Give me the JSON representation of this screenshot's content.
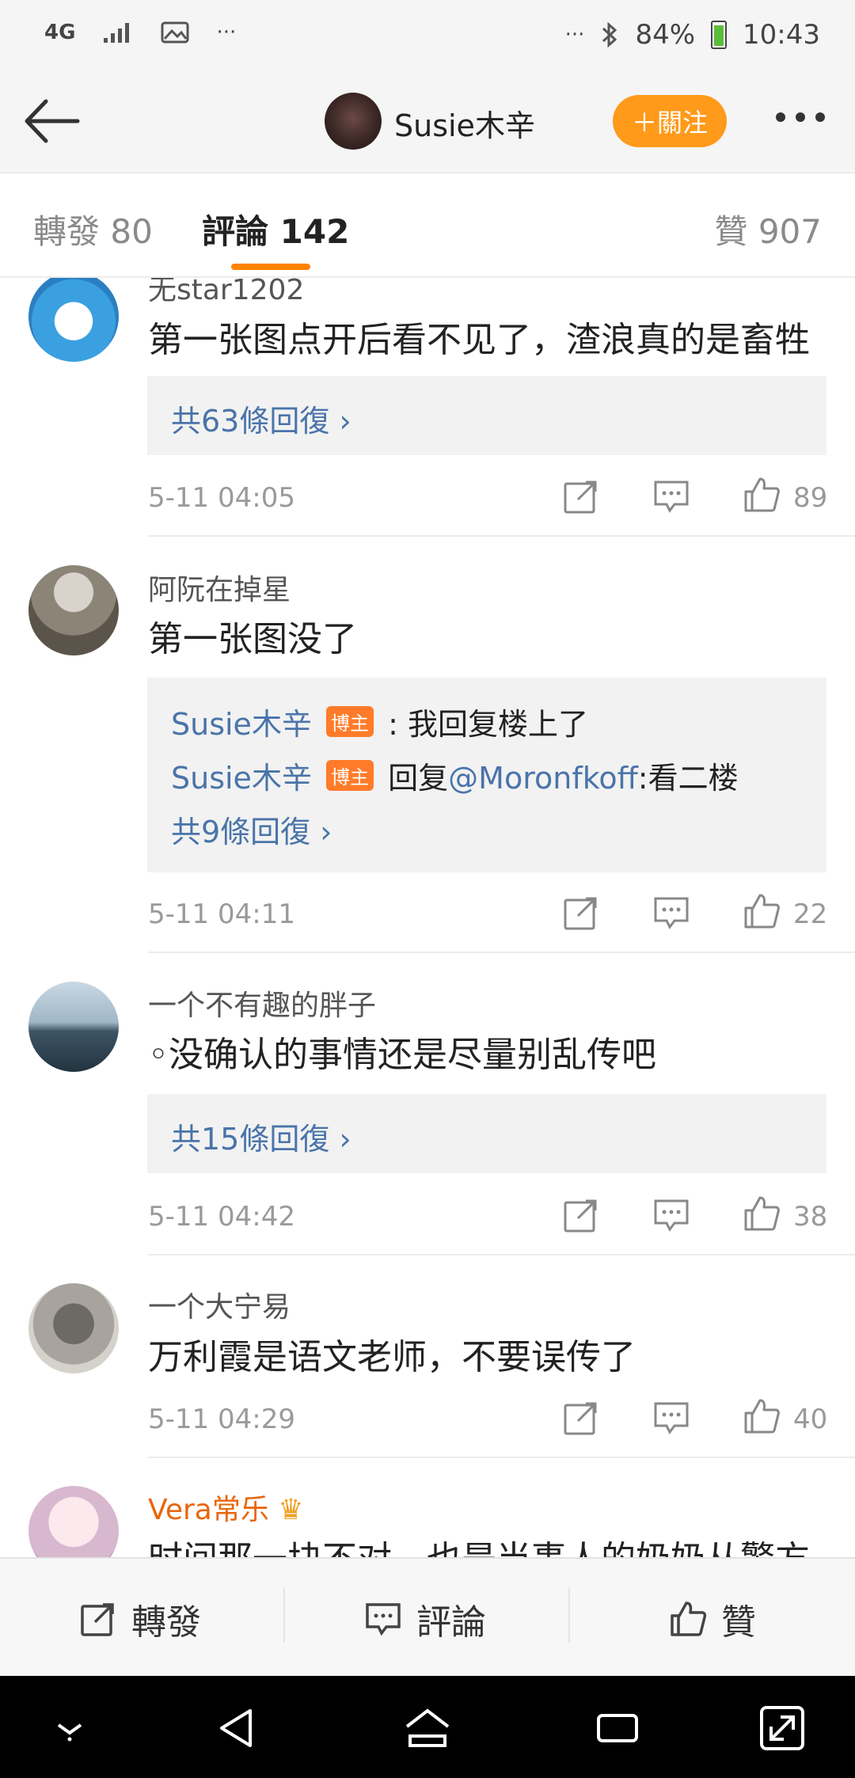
{
  "status": {
    "network": "4G",
    "battery": "84%",
    "time": "10:43",
    "more": "···"
  },
  "header": {
    "username": "Susie木辛",
    "follow_label": "＋關注"
  },
  "tabs": {
    "repost": "轉發 80",
    "comments": "評論 142",
    "likes": "贊 907"
  },
  "comments": [
    {
      "username": "无star1202",
      "content": "第一张图点开后看不见了，渣浪真的是畜牲",
      "reply_count": "共63條回復",
      "time": "5-11 04:05",
      "likes": "89"
    },
    {
      "username": "阿阮在掉星",
      "content": "第一张图没了",
      "replies": [
        {
          "user": "Susie木辛",
          "badge": "博主",
          "text": ": 我回复楼上了"
        },
        {
          "user": "Susie木辛",
          "badge": "博主",
          "prefix": "回复",
          "mention": "@Moronfkoff",
          "text": ":看二楼"
        }
      ],
      "reply_count": "共9條回復",
      "time": "5-11 04:11",
      "likes": "22"
    },
    {
      "username": "一个不有趣的胖子",
      "content": "◦没确认的事情还是尽量别乱传吧",
      "reply_count": "共15條回復",
      "time": "5-11 04:42",
      "likes": "38"
    },
    {
      "username": "一个大宁易",
      "content": "万利霞是语文老师，不要误传了",
      "time": "5-11 04:29",
      "likes": "40"
    },
    {
      "username": "Vera常乐",
      "content": "时间那一块不对，也是当事人的奶奶从警方"
    }
  ],
  "bottom": {
    "repost": "轉發",
    "comment": "評論",
    "like": "贊"
  },
  "colors": {
    "accent": "#ff8200",
    "link": "#4a74a9",
    "badge": "#ff7b29"
  }
}
